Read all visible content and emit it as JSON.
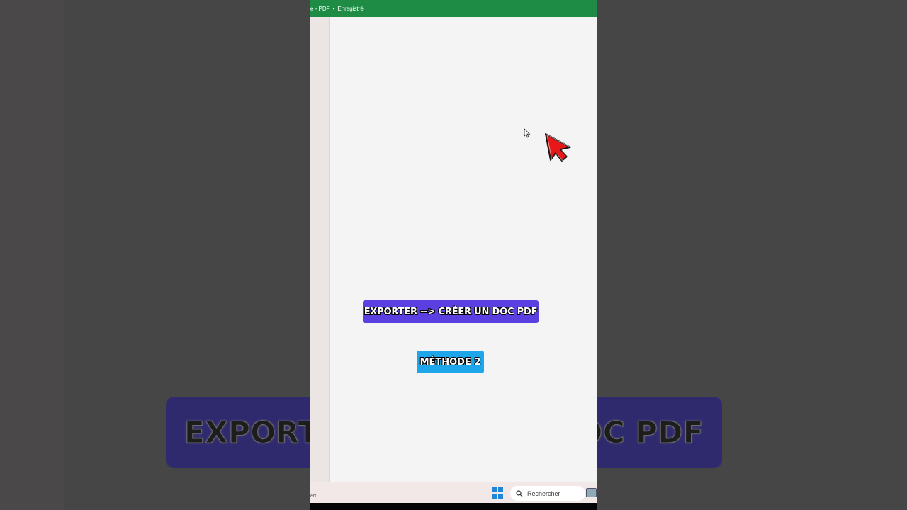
{
  "window": {
    "title_prefix": "e - PDF",
    "title_status": "Enregistré"
  },
  "overlays": {
    "step_label": "EXPORTER --> CRÉER UN DOC PDF",
    "method_label": "MÉTHODE 2"
  },
  "background_banner": {
    "left_text": "EXPORTE",
    "right_text": "OC PDF"
  },
  "statusbar": {
    "text": "ert"
  },
  "taskbar": {
    "search_placeholder": "Rechercher"
  },
  "colors": {
    "titlebar": "#1e8c45",
    "step_label_bg": "#5b3fe0",
    "method_label_bg": "#1da6ea",
    "cursor_red": "#e81818"
  },
  "icons": {
    "start": "windows-logo-icon",
    "search": "search-icon",
    "tray": "tray-app-icon",
    "cursor_small": "mouse-pointer-icon",
    "cursor_big": "red-arrow-pointer-icon"
  }
}
